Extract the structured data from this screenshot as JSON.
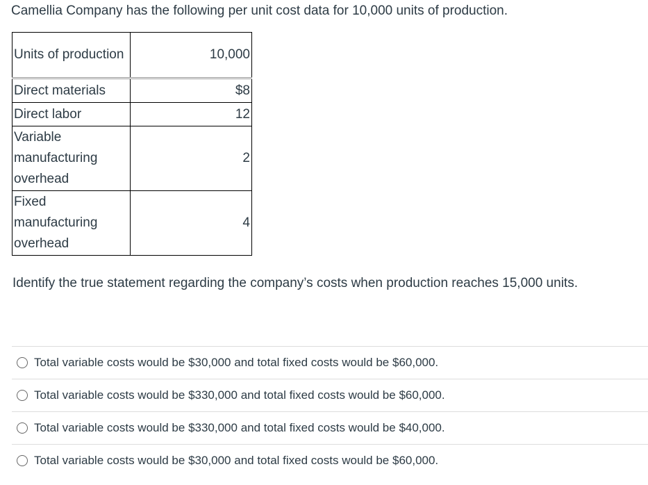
{
  "intro_text": "Camellia Company has the following per unit cost data for 10,000 units of production.",
  "table": {
    "header": {
      "label": "Units of production",
      "value": "10,000"
    },
    "rows": [
      {
        "label": "Direct materials",
        "value": "$8"
      },
      {
        "label": "Direct labor",
        "value": "12"
      },
      {
        "label": "Variable manufacturing overhead",
        "value": "2"
      },
      {
        "label": "Fixed manufacturing overhead",
        "value": "4"
      }
    ]
  },
  "question_text": "Identify the true statement regarding the company’s costs when production reaches 15,000 units.",
  "answers": [
    {
      "label": "Total variable costs would be $30,000 and total fixed costs would be $60,000."
    },
    {
      "label": "Total variable costs would be $330,000 and total fixed costs would be $60,000."
    },
    {
      "label": "Total variable costs would be $330,000 and total fixed costs would be $40,000."
    },
    {
      "label": "Total variable costs would be $30,000 and total fixed costs would be $60,000."
    }
  ]
}
